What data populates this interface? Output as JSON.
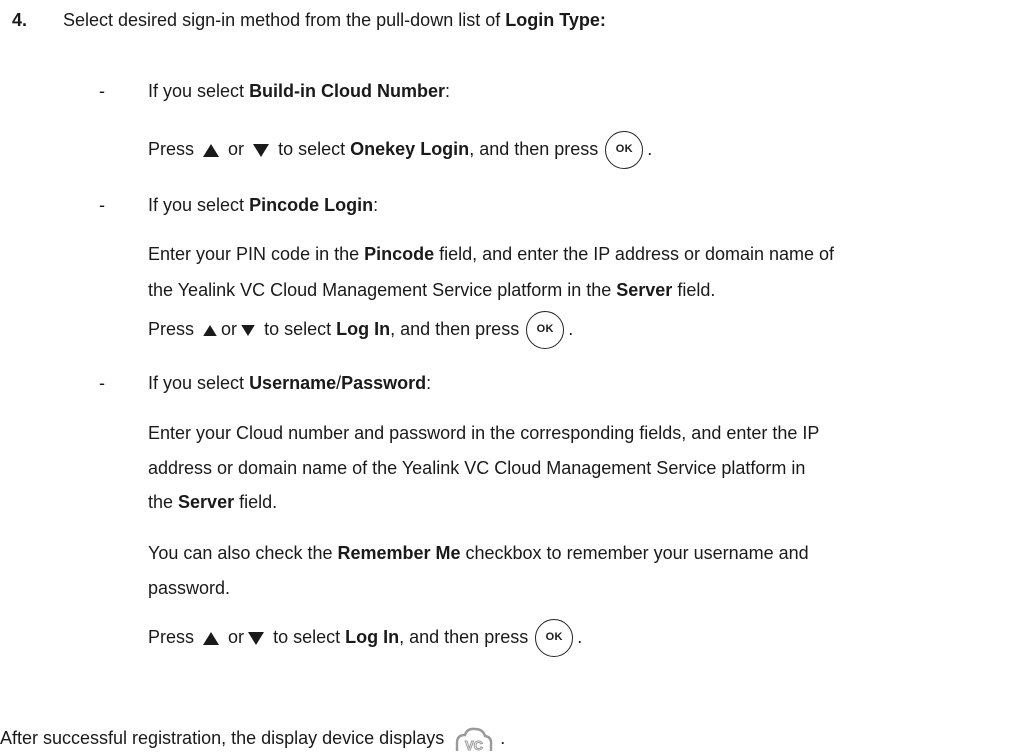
{
  "step": {
    "number": "4.",
    "intro_a": "Select desired sign-in method from the pull-down list of ",
    "intro_b": "Login Type:"
  },
  "opt1": {
    "dash": "-",
    "heading_a": "If you select ",
    "heading_b": "Build-in Cloud Number",
    "heading_c": ":",
    "press_a": "Press",
    "or": "or",
    "to_select": "to select",
    "target": "Onekey Login",
    "then_press": ", and then press",
    "end": "."
  },
  "opt2": {
    "dash": "-",
    "heading_a": "If you select ",
    "heading_b": "Pincode Login",
    "heading_c": ":",
    "l1_a": "Enter your PIN code in the ",
    "l1_b": "Pincode",
    "l1_c": " field, and enter the IP address or domain name of",
    "l2_a": "the Yealink VC Cloud Management Service platform in the ",
    "l2_b": "Server",
    "l2_c": " field.",
    "press_a": "Press",
    "or": "or",
    "to_select": "to select",
    "target": "Log In",
    "then_press": ", and then press",
    "end": "."
  },
  "opt3": {
    "dash": "-",
    "heading_a": "If you select ",
    "heading_b": "Username",
    "heading_slash": "/",
    "heading_c": "Password",
    "heading_d": ":",
    "l1": "Enter your Cloud number and password in the corresponding fields, and enter the IP",
    "l2": "address or domain name of the Yealink VC Cloud Management Service platform in",
    "l3_a": "the ",
    "l3_b": "Server",
    "l3_c": " field.",
    "l4_a": "You can also check the ",
    "l4_b": "Remember Me",
    "l4_c": " checkbox to remember your username and",
    "l5": "password.",
    "press_a": "Press",
    "or": "or",
    "to_select": "to select",
    "target": "Log In",
    "then_press": ", and then press",
    "end": "."
  },
  "after": {
    "text": "After successful registration, the display device displays",
    "end": "."
  },
  "icons": {
    "ok_label": "OK",
    "vc_label": "VC"
  },
  "colors": {
    "text": "#1a1a1a",
    "icon_stroke": "#222222",
    "vc_icon": "#9a9a9a"
  }
}
